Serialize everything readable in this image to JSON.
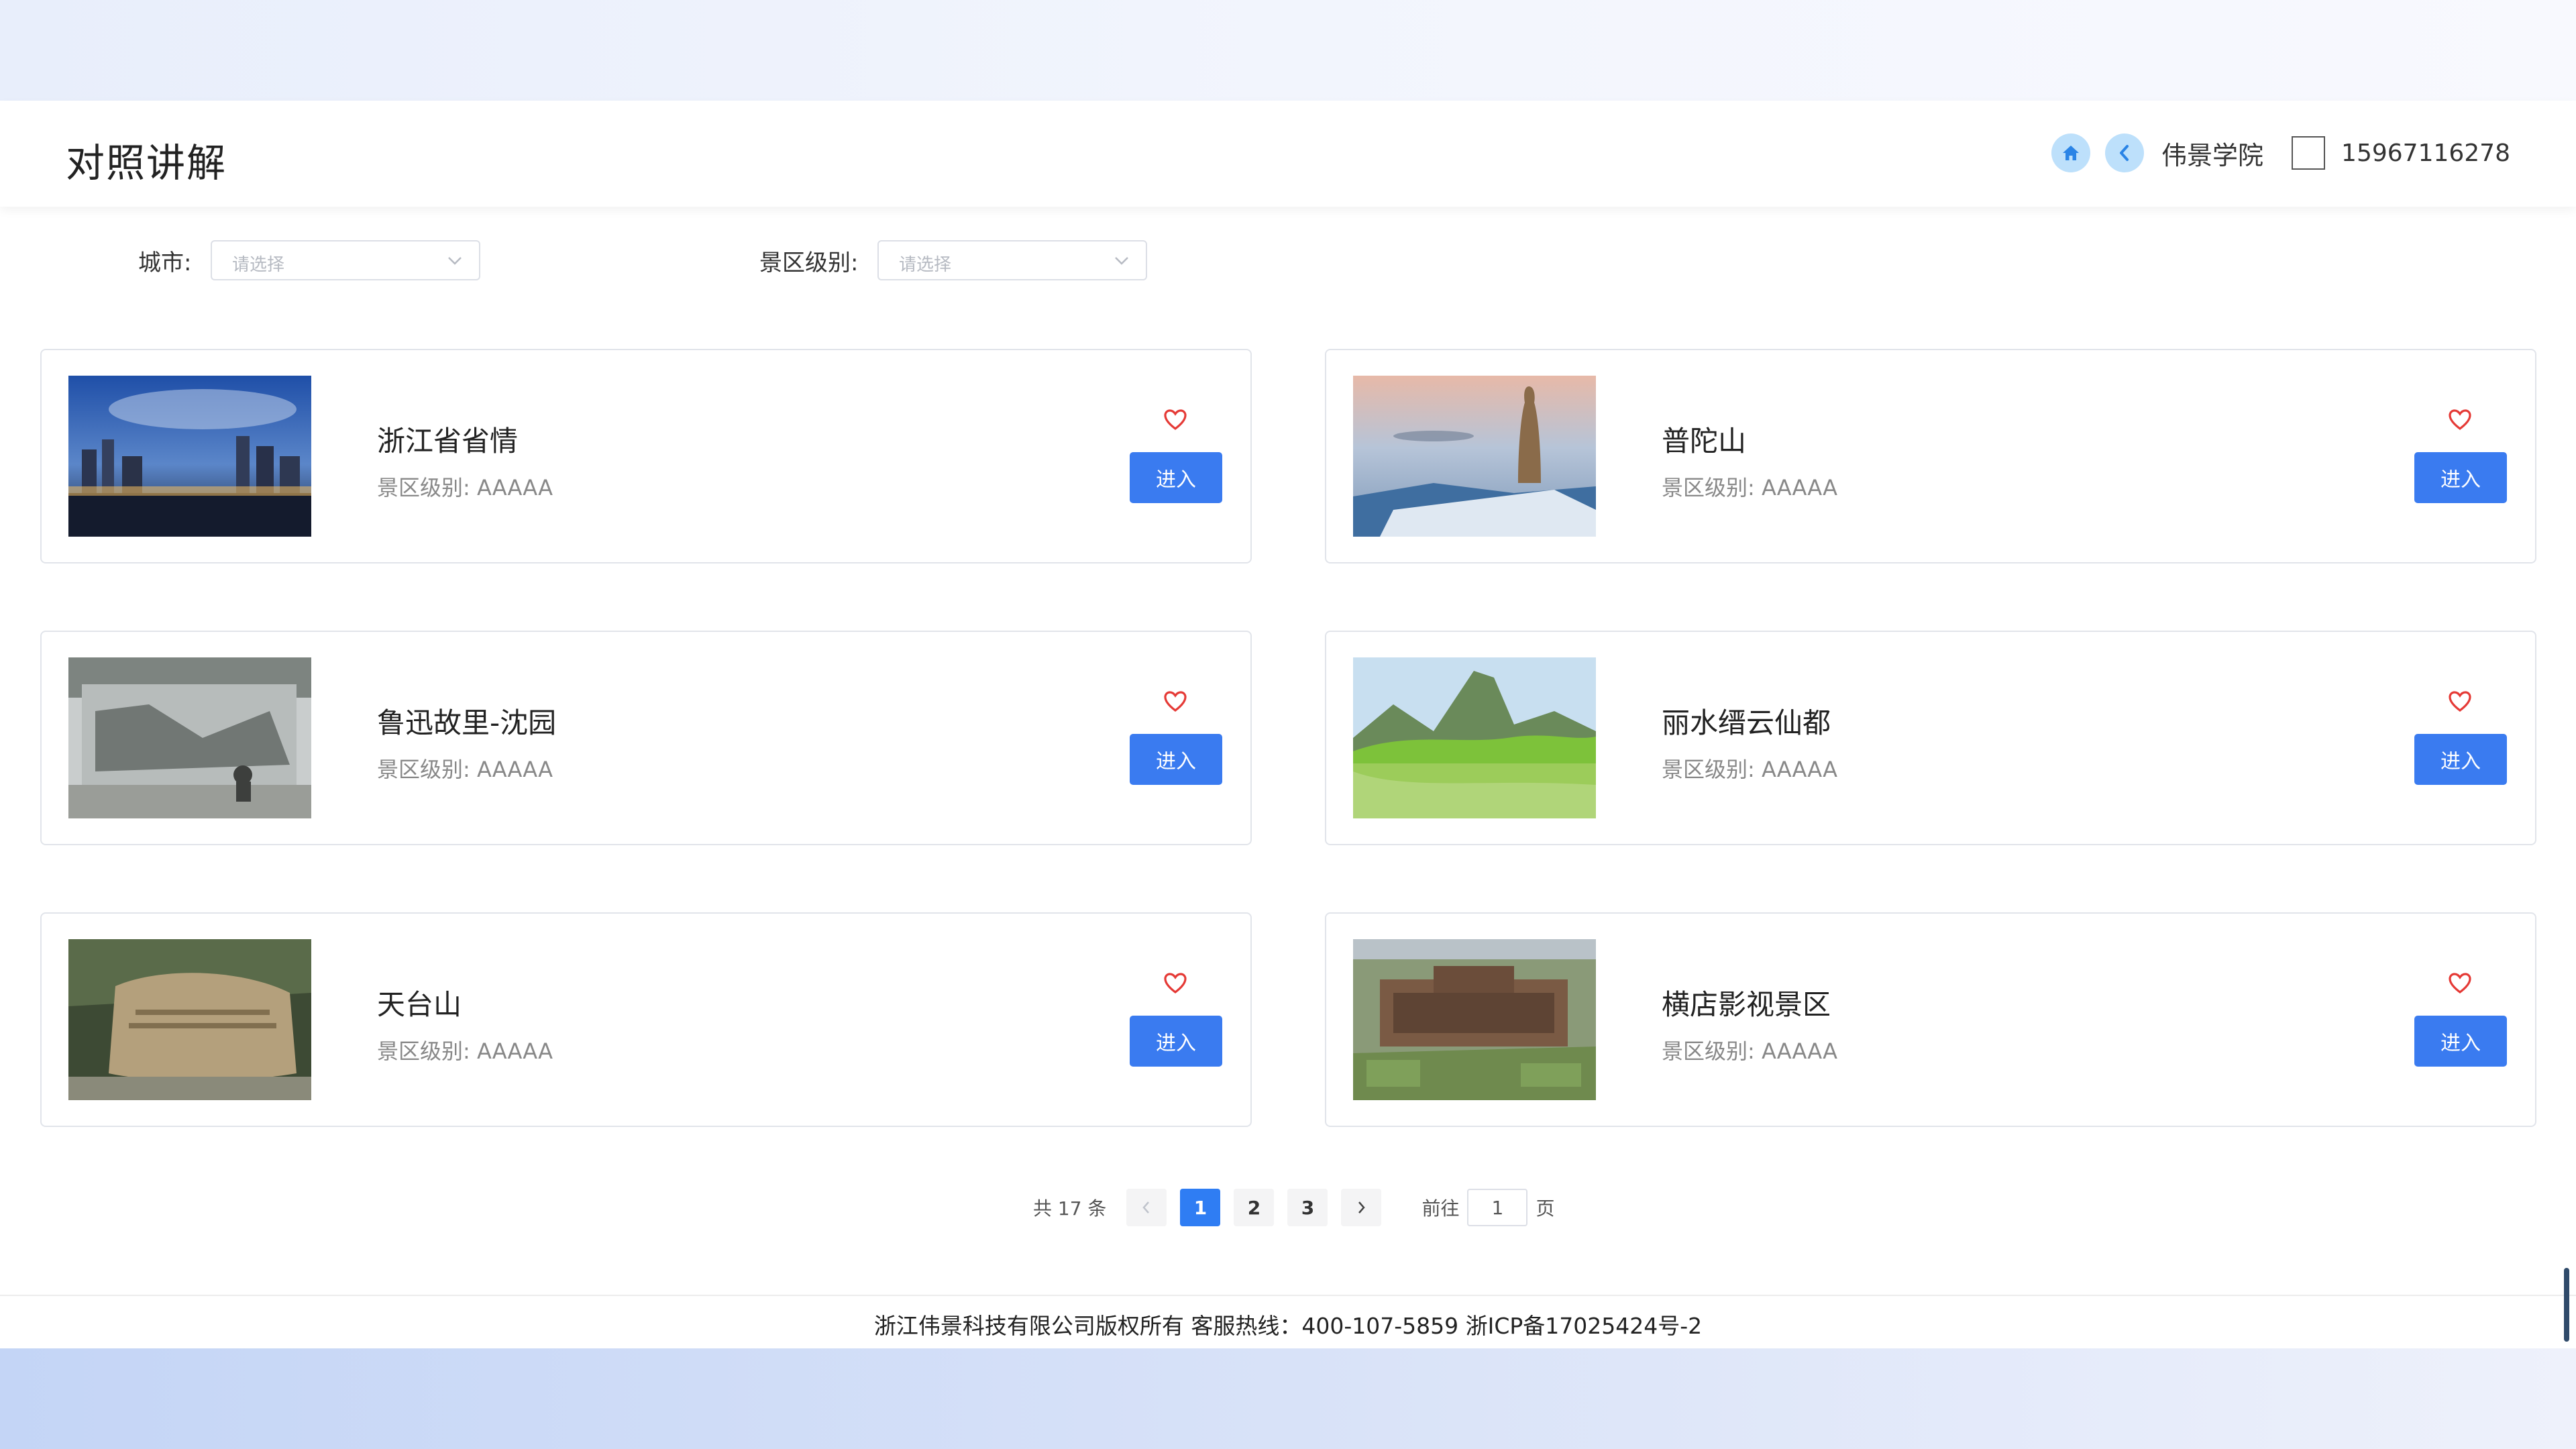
{
  "header": {
    "title": "对照讲解",
    "org_name": "伟景学院",
    "phone": "15967116278"
  },
  "filters": {
    "city": {
      "label": "城市:",
      "placeholder": "请选择"
    },
    "level": {
      "label": "景区级别:",
      "placeholder": "请选择"
    }
  },
  "cards": [
    {
      "title": "浙江省省情",
      "level": "景区级别: AAAAA",
      "button": "进入"
    },
    {
      "title": "普陀山",
      "level": "景区级别: AAAAA",
      "button": "进入"
    },
    {
      "title": "鲁迅故里-沈园",
      "level": "景区级别: AAAAA",
      "button": "进入"
    },
    {
      "title": "丽水缙云仙都",
      "level": "景区级别: AAAAA",
      "button": "进入"
    },
    {
      "title": "天台山",
      "level": "景区级别: AAAAA",
      "button": "进入"
    },
    {
      "title": "横店影视景区",
      "level": "景区级别: AAAAA",
      "button": "进入"
    }
  ],
  "pagination": {
    "total": "共 17 条",
    "pages": [
      "1",
      "2",
      "3"
    ],
    "current": "1",
    "goto_label": "前往",
    "goto_value": "1",
    "page_word": "页"
  },
  "footer": {
    "text": "浙江伟景科技有限公司版权所有 客服热线：400-107-5859 浙ICP备17025424号-2"
  },
  "colors": {
    "primary": "#3a7bf0",
    "heart": "#e53935",
    "nav_circle": "#bde0fb"
  }
}
